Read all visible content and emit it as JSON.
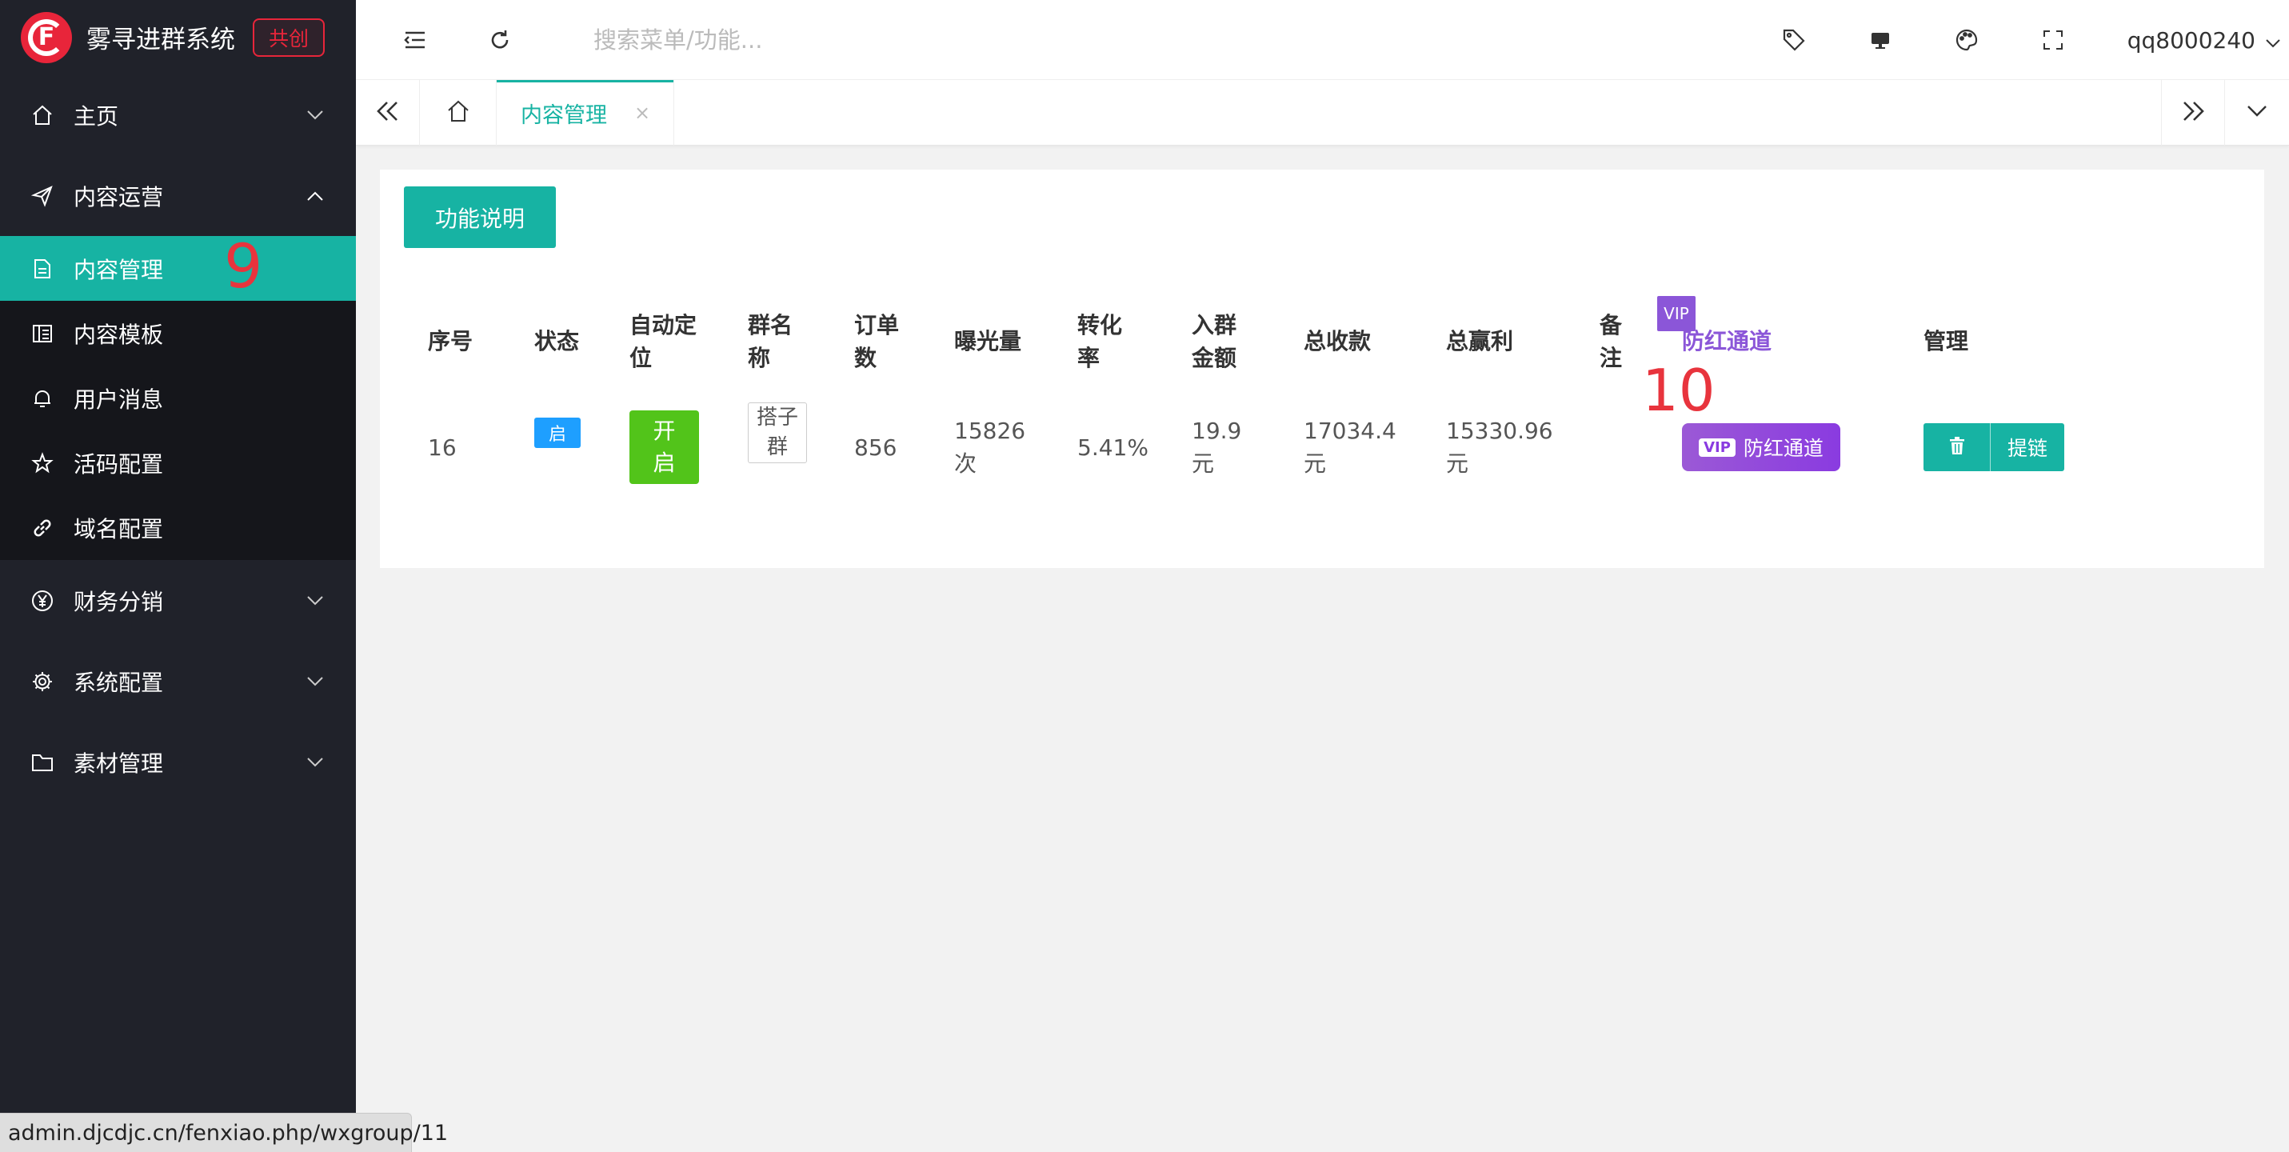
{
  "app": {
    "title": "雾寻进群系统",
    "badge": "共创",
    "brand_color": "#e8253a",
    "accent_color": "#17b3a3"
  },
  "sidebar": {
    "groups": [
      {
        "label": "主页",
        "icon": "home-icon",
        "expanded": false
      },
      {
        "label": "内容运营",
        "icon": "send-icon",
        "expanded": true
      },
      {
        "label": "财务分销",
        "icon": "yen-icon",
        "expanded": false
      },
      {
        "label": "系统配置",
        "icon": "gear-icon",
        "expanded": false
      },
      {
        "label": "素材管理",
        "icon": "folder-icon",
        "expanded": false
      }
    ],
    "subitems": [
      {
        "label": "内容管理",
        "icon": "document-icon",
        "active": true
      },
      {
        "label": "内容模板",
        "icon": "template-icon",
        "active": false
      },
      {
        "label": "用户消息",
        "icon": "bell-icon",
        "active": false
      },
      {
        "label": "活码配置",
        "icon": "star-icon",
        "active": false
      },
      {
        "label": "域名配置",
        "icon": "link-icon",
        "active": false
      }
    ]
  },
  "header": {
    "search_placeholder": "搜索菜单/功能...",
    "username": "qq8000240"
  },
  "tabs": {
    "active_label": "内容管理",
    "close_glyph": "×"
  },
  "content": {
    "help_button": "功能说明",
    "vip_badge": "VIP",
    "columns": [
      "序号",
      "状态",
      "自动定位",
      "群名称",
      "订单数",
      "曝光量",
      "转化率",
      "入群金额",
      "总收款",
      "总赢利",
      "备注",
      "防红通道",
      "管理"
    ],
    "row": {
      "id": "16",
      "state": "启",
      "auto_locate": "开启",
      "group_name": "搭子群",
      "orders": "856",
      "exposure": "15826次",
      "conversion": "5.41%",
      "join_fee": "19.9元",
      "total_income": "17034.4元",
      "total_profit": "15330.96元",
      "remark": "",
      "vip_channel_tag": "VIP",
      "vip_channel_label": "防红通道",
      "link_button": "提链"
    }
  },
  "annotations": {
    "marker_9": "9",
    "marker_10": "10"
  },
  "status_bar": {
    "url": "admin.djcdjc.cn/fenxiao.php/wxgroup/11"
  }
}
